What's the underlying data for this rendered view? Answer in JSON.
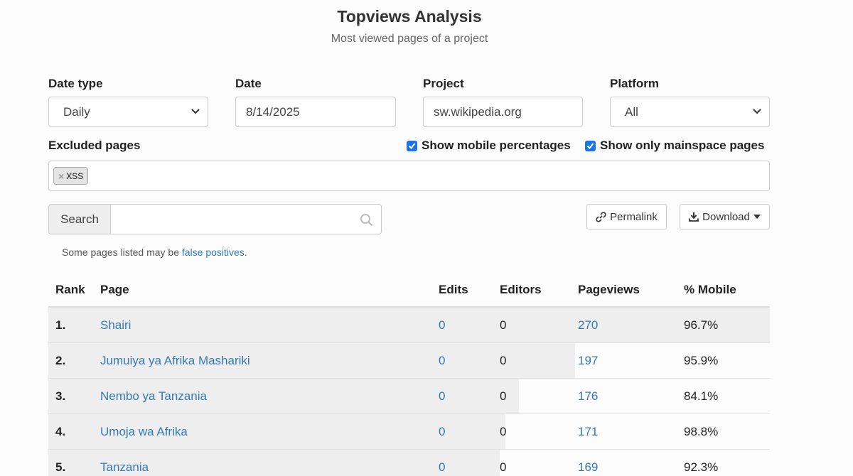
{
  "header": {
    "title": "Topviews Analysis",
    "subtitle": "Most viewed pages of a project"
  },
  "form": {
    "date_type": {
      "label": "Date type",
      "value": "Daily"
    },
    "date": {
      "label": "Date",
      "value": "8/14/2025"
    },
    "project": {
      "label": "Project",
      "value": "sw.wikipedia.org"
    },
    "platform": {
      "label": "Platform",
      "value": "All"
    },
    "excluded": {
      "label": "Excluded pages",
      "tags": [
        "xss"
      ],
      "remove_glyph": "×"
    },
    "show_mobile": {
      "label": "Show mobile percentages",
      "checked": true
    },
    "mainspace_only": {
      "label": "Show only mainspace pages",
      "checked": true
    }
  },
  "search": {
    "addon": "Search",
    "value": "",
    "placeholder": ""
  },
  "buttons": {
    "permalink": "Permalink",
    "download": "Download"
  },
  "note": {
    "text": "Some pages listed may be ",
    "link": "false positives",
    "suffix": "."
  },
  "table": {
    "columns": [
      "Rank",
      "Page",
      "Edits",
      "Editors",
      "Pageviews",
      "% Mobile"
    ],
    "rows": [
      {
        "rank": "1.",
        "page": "Shairi",
        "edits": "0",
        "editors": "0",
        "pageviews": "270",
        "mobile": "96.7%",
        "views": 270
      },
      {
        "rank": "2.",
        "page": "Jumuiya ya Afrika Mashariki",
        "edits": "0",
        "editors": "0",
        "pageviews": "197",
        "mobile": "95.9%",
        "views": 197
      },
      {
        "rank": "3.",
        "page": "Nembo ya Tanzania",
        "edits": "0",
        "editors": "0",
        "pageviews": "176",
        "mobile": "84.1%",
        "views": 176
      },
      {
        "rank": "4.",
        "page": "Umoja wa Afrika",
        "edits": "0",
        "editors": "0",
        "pageviews": "171",
        "mobile": "98.8%",
        "views": 171
      },
      {
        "rank": "5.",
        "page": "Tanzania",
        "edits": "0",
        "editors": "0",
        "pageviews": "169",
        "mobile": "92.3%",
        "views": 169
      }
    ]
  },
  "colors": {
    "accent": "#337ab7",
    "checkbox": "#1a73e8",
    "bar": "#eeeeee"
  }
}
